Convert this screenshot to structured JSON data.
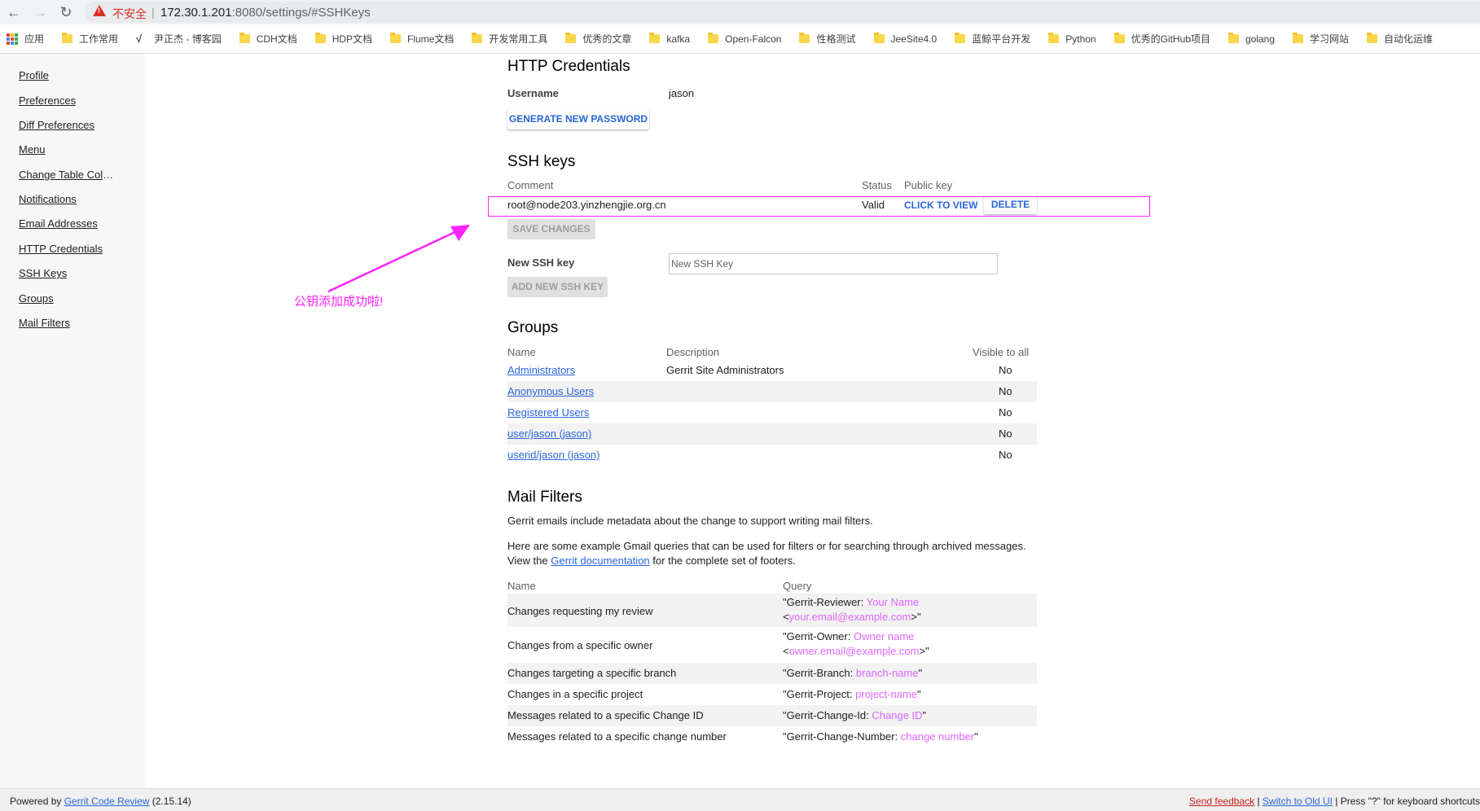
{
  "browser": {
    "security_label": "不安全",
    "url_host": "172.30.1.201",
    "url_rest": ":8080/settings/#SSHKeys",
    "bookmarks": [
      "应用",
      "工作常用",
      "尹正杰 - 博客园",
      "CDH文档",
      "HDP文档",
      "Flume文档",
      "开发常用工具",
      "优秀的文章",
      "kafka",
      "Open-Falcon",
      "性格测试",
      "JeeSite4.0",
      "蓝鲸平台开发",
      "Python",
      "优秀的GitHub项目",
      "golang",
      "学习网站",
      "自动化运维"
    ]
  },
  "sidebar": {
    "items": [
      "Profile",
      "Preferences",
      "Diff Preferences",
      "Menu",
      "Change Table Columns",
      "Notifications",
      "Email Addresses",
      "HTTP Credentials",
      "SSH Keys",
      "Groups",
      "Mail Filters"
    ]
  },
  "http": {
    "title": "HTTP Credentials",
    "username_label": "Username",
    "username_value": "jason",
    "generate_button": "GENERATE NEW PASSWORD"
  },
  "ssh": {
    "title": "SSH keys",
    "headers": [
      "Comment",
      "Status",
      "Public key"
    ],
    "key_comment": "root@node203.yinzhengjie.org.cn",
    "key_status": "Valid",
    "view_button": "CLICK TO VIEW",
    "delete_button": "DELETE",
    "save_button": "SAVE CHANGES",
    "new_key_label": "New SSH key",
    "new_key_placeholder": "New SSH Key",
    "add_button": "ADD NEW SSH KEY"
  },
  "annotation": {
    "text": "公钥添加成功啦!"
  },
  "groups": {
    "title": "Groups",
    "headers": [
      "Name",
      "Description",
      "Visible to all"
    ],
    "rows": [
      {
        "name": "Administrators",
        "description": "Gerrit Site Administrators",
        "visible": "No"
      },
      {
        "name": "Anonymous Users",
        "description": "",
        "visible": "No"
      },
      {
        "name": "Registered Users",
        "description": "",
        "visible": "No"
      },
      {
        "name": "user/jason (jason)",
        "description": "",
        "visible": "No"
      },
      {
        "name": "userid/jason (jason)",
        "description": "",
        "visible": "No"
      }
    ]
  },
  "mail": {
    "title": "Mail Filters",
    "intro": "Gerrit emails include metadata about the change to support writing mail filters.",
    "para_line1": "Here are some example Gmail queries that can be used for filters or for searching through archived messages.",
    "para_view": "View the",
    "para_link": "Gerrit documentation",
    "para_rest": "for the complete set of footers.",
    "headers": [
      "Name",
      "Query"
    ],
    "rows": [
      {
        "name": "Changes requesting my review",
        "q1": "\"Gerrit-Reviewer: ",
        "p1": "Your Name",
        "q2": "<",
        "p2": "your.email@example.com",
        "q3": ">\""
      },
      {
        "name": "Changes from a specific owner",
        "q1": "\"Gerrit-Owner: ",
        "p1": "Owner name",
        "q2": "<",
        "p2": "owner.email@example.com",
        "q3": ">\""
      },
      {
        "name": "Changes targeting a specific branch",
        "q1": "\"Gerrit-Branch: ",
        "p1": "branch-name",
        "q3": "\""
      },
      {
        "name": "Changes in a specific project",
        "q1": "\"Gerrit-Project: ",
        "p1": "project-name",
        "q3": "\""
      },
      {
        "name": "Messages related to a specific Change ID",
        "q1": "\"Gerrit-Change-Id: ",
        "p1": "Change ID",
        "q3": "\""
      },
      {
        "name": "Messages related to a specific change number",
        "q1": "\"Gerrit-Change-Number: ",
        "p1": "change number",
        "q3": "\""
      }
    ]
  },
  "footer": {
    "powered_by": "Powered by",
    "gerrit_link": "Gerrit Code Review",
    "version": "(2.15.14)",
    "send_feedback": "Send feedback",
    "sep": "|",
    "switch_old": "Switch to Old UI",
    "press_hint": "| Press \"?\" for keyboard shortcuts"
  }
}
